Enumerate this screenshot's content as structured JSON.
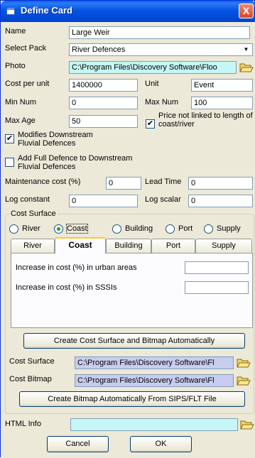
{
  "window": {
    "title": "Define Card",
    "close_symbol": "X"
  },
  "fields": {
    "name_label": "Name",
    "name_value": "Large Weir",
    "select_pack_label": "Select Pack",
    "select_pack_value": "River Defences",
    "photo_label": "Photo",
    "photo_value": "C:\\Program Files\\Discovery Software\\Floo",
    "cost_per_unit_label": "Cost per unit",
    "cost_per_unit_value": "1400000",
    "unit_label": "Unit",
    "unit_value": "Event",
    "min_num_label": "Min Num",
    "min_num_value": "0",
    "max_num_label": "Max Num",
    "max_num_value": "100",
    "max_age_label": "Max Age",
    "max_age_value": "50",
    "price_not_linked_label": "Price not linked to length of coast/river",
    "price_not_linked_checked": true,
    "modifies_downstream_label": "Modifies Downstream Fluvial Defences",
    "modifies_downstream_checked": true,
    "add_full_defence_label": "Add Full Defence to Downstream Fluvial Defences",
    "add_full_defence_checked": false,
    "maintenance_cost_label": "Maintenance cost (%)",
    "maintenance_cost_value": "0",
    "lead_time_label": "Lead Time",
    "lead_time_value": "0",
    "log_constant_label": "Log constant",
    "log_constant_value": "0",
    "log_scalar_label": "Log scalar",
    "log_scalar_value": "0"
  },
  "cost_surface": {
    "group_label": "Cost Surface",
    "radios": [
      "River",
      "Coast",
      "Building",
      "Port",
      "Supply"
    ],
    "selected_radio": "Coast",
    "tabs": [
      "River",
      "Coast",
      "Building",
      "Port",
      "Supply"
    ],
    "active_tab": "Coast",
    "urban_label": "Increase in cost (%) in urban areas",
    "urban_value": "",
    "sssi_label": "Increase in cost (%) in SSSIs",
    "sssi_value": "",
    "create_button": "Create Cost Surface and Bitmap Automatically",
    "cost_surface_label": "Cost Surface",
    "cost_surface_value": "C:\\Program Files\\Discovery Software\\Fl",
    "cost_bitmap_label": "Cost Bitmap",
    "cost_bitmap_value": "C:\\Program Files\\Discovery Software\\Fl",
    "create_bitmap_button": "Create Bitmap Automatically From SIPS/FLT File"
  },
  "html_info": {
    "label": "HTML Info",
    "value": ""
  },
  "buttons": {
    "cancel": "Cancel",
    "ok": "OK"
  },
  "colors": {
    "title_bar": "#0554e3",
    "cyan_field": "#c6f7f7",
    "lavender_field": "#c8cdf0",
    "dialog_bg": "#ece9d8"
  },
  "icons": {
    "combo_arrow": "chevron-down-icon",
    "browse": "folder-open-icon",
    "title": "window-icon",
    "close": "close-icon"
  }
}
